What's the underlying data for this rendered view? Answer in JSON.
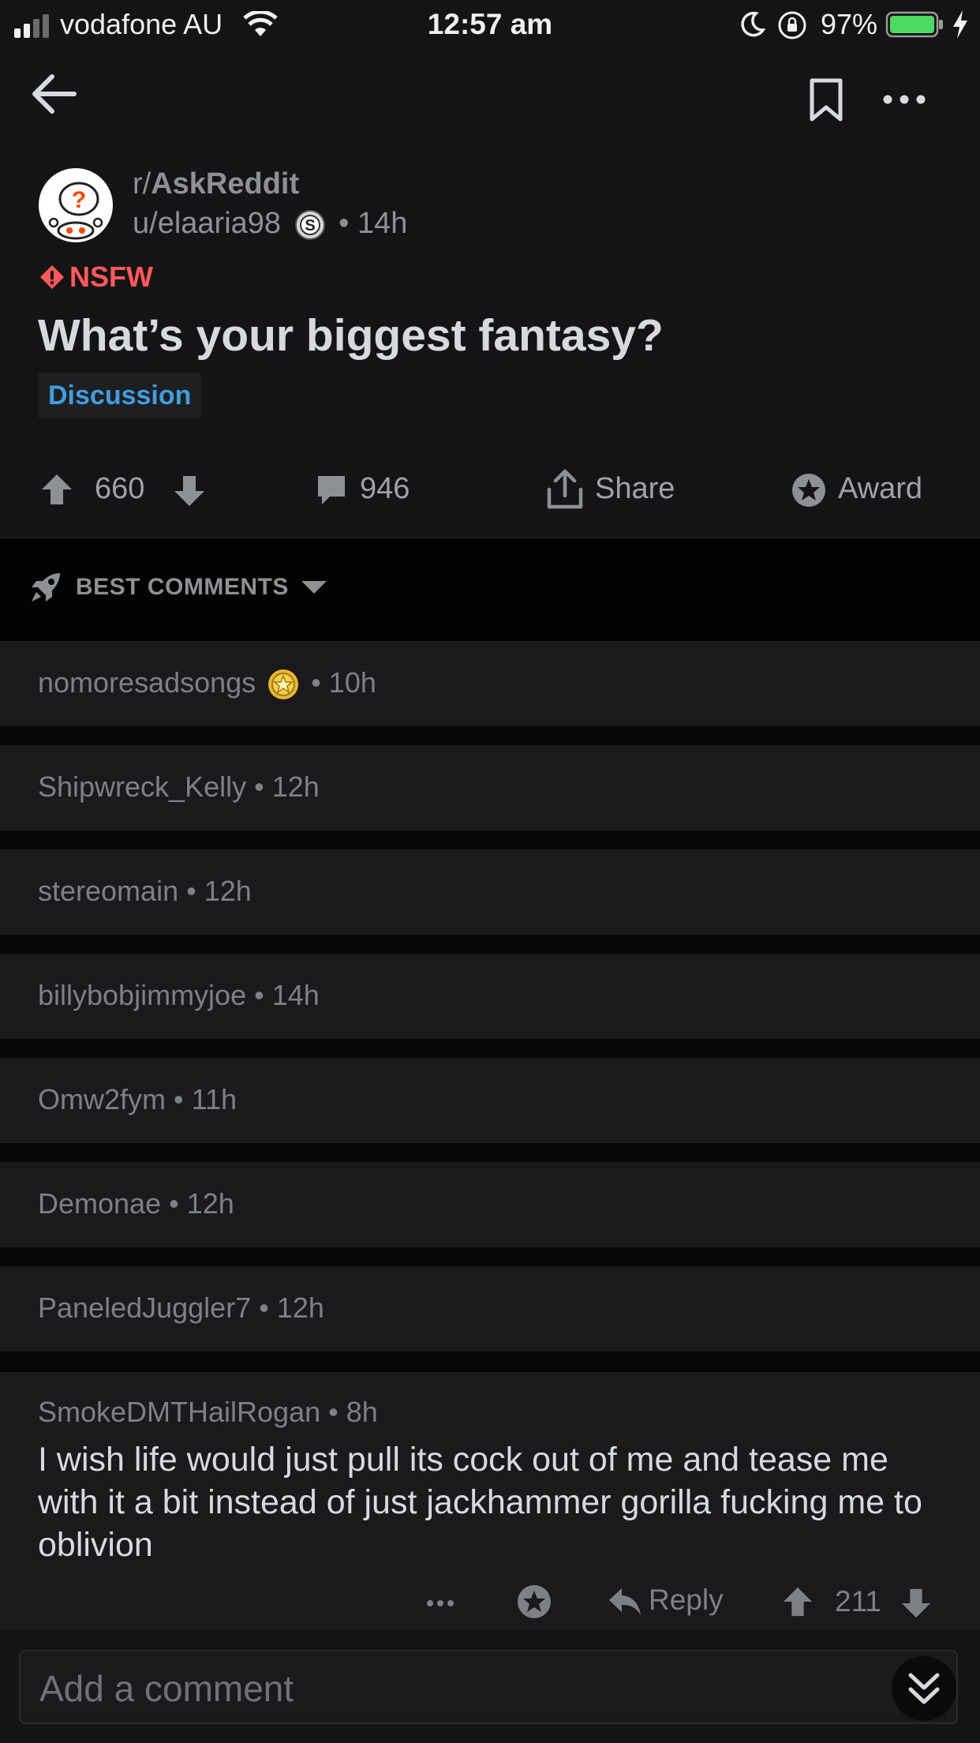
{
  "status_bar": {
    "carrier": "vodafone AU",
    "time": "12:57 am",
    "battery_percent": "97%"
  },
  "toolbar": {
    "back_icon": "arrow-left-icon",
    "save_icon": "bookmark-icon",
    "more_icon": "more-horizontal-icon"
  },
  "post": {
    "subreddit_prefix": "r/",
    "subreddit": "AskReddit",
    "author": "u/elaaria98",
    "age": "• 14h",
    "nsfw_label": "NSFW",
    "title": "What’s your biggest fantasy?",
    "flair": "Discussion",
    "score": "660",
    "comment_count": "946",
    "share_label": "Share",
    "award_label": "Award"
  },
  "sort": {
    "label": "BEST COMMENTS"
  },
  "collapsed_comments": [
    {
      "author": "nomoresadsongs",
      "age": "• 10h"
    },
    {
      "author": "Shipwreck_Kelly",
      "age": "• 12h"
    },
    {
      "author": "stereomain",
      "age": "• 12h"
    },
    {
      "author": "billybobjimmyjoe",
      "age": "• 14h"
    },
    {
      "author": "Omw2fym",
      "age": "• 11h"
    },
    {
      "author": "Demonae",
      "age": "• 12h"
    },
    {
      "author": "PaneledJuggler7",
      "age": "• 12h"
    }
  ],
  "expanded_comment": {
    "author": "SmokeDMTHailRogan",
    "age": "• 8h",
    "body": "I wish life would just pull its cock out of me and tease me with it a bit instead of just jackhammer gorilla fucking me to oblivion",
    "reply_label": "Reply",
    "score": "211"
  },
  "composer": {
    "placeholder": "Add a comment"
  },
  "colors": {
    "background": "#141416",
    "nsfw": "#ff585b",
    "flair_text": "#3d9ee0",
    "battery_fill": "#4cd964"
  }
}
